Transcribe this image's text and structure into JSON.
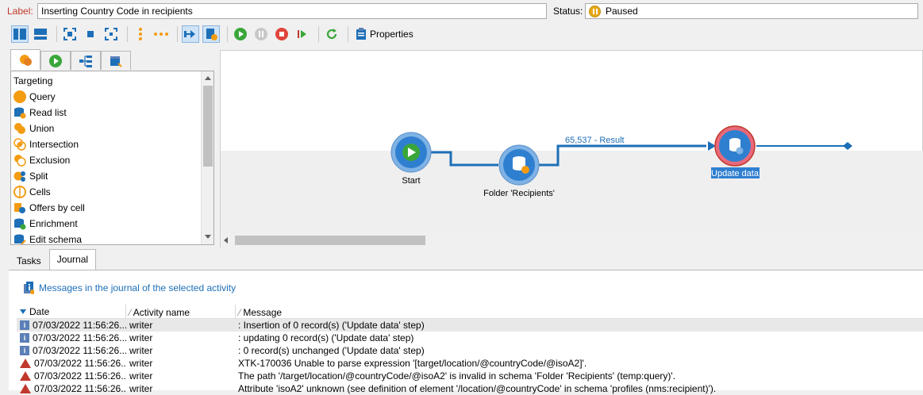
{
  "top": {
    "label_caption": "Label:",
    "label_value": "Inserting Country Code in recipients",
    "status_caption": "Status:",
    "status_value": "Paused"
  },
  "toolbar": {
    "properties_label": "Properties",
    "icons": [
      "layout-vertical-icon",
      "layout-horizontal-icon",
      "zoom-fit-icon",
      "zoom-stop-icon",
      "fit-selection-icon",
      "vertical-dots-icon",
      "horizontal-dots-icon",
      "auto-layout-icon",
      "workflow-properties-icon",
      "start-icon",
      "pause-icon",
      "stop-icon",
      "step-icon",
      "refresh-icon",
      "properties-icon"
    ]
  },
  "palette": {
    "tabs": [
      "targeting-tab",
      "flow-control-tab",
      "actions-tab",
      "events-tab"
    ],
    "section": "Targeting",
    "items": [
      {
        "label": "Query",
        "icon": "query-icon"
      },
      {
        "label": "Read list",
        "icon": "read-list-icon"
      },
      {
        "label": "Union",
        "icon": "union-icon"
      },
      {
        "label": "Intersection",
        "icon": "intersection-icon"
      },
      {
        "label": "Exclusion",
        "icon": "exclusion-icon"
      },
      {
        "label": "Split",
        "icon": "split-icon"
      },
      {
        "label": "Cells",
        "icon": "cells-icon"
      },
      {
        "label": "Offers by cell",
        "icon": "offers-by-cell-icon"
      },
      {
        "label": "Enrichment",
        "icon": "enrichment-icon"
      },
      {
        "label": "Edit schema",
        "icon": "edit-schema-icon"
      }
    ]
  },
  "canvas": {
    "nodes": {
      "start": "Start",
      "folder": "Folder 'Recipients'",
      "update": "Update data"
    },
    "transition_label": "65,537 - Result"
  },
  "bottom": {
    "tabs": [
      "Tasks",
      "Journal"
    ],
    "journal_title": "Messages in the journal of the selected activity",
    "columns": [
      "Date",
      "Activity name",
      "Message"
    ],
    "rows": [
      {
        "type": "info",
        "date": "07/03/2022 11:56:26...",
        "activity": "writer",
        "message": ": Insertion of 0 record(s) ('Update data' step)"
      },
      {
        "type": "info",
        "date": "07/03/2022 11:56:26...",
        "activity": "writer",
        "message": ": updating 0 record(s) ('Update data' step)"
      },
      {
        "type": "info",
        "date": "07/03/2022 11:56:26...",
        "activity": "writer",
        "message": ": 0 record(s) unchanged ('Update data' step)"
      },
      {
        "type": "error",
        "date": "07/03/2022 11:56:26...",
        "activity": "writer",
        "message": "XTK-170036 Unable to parse expression '[target/location/@countryCode/@isoA2]'."
      },
      {
        "type": "error",
        "date": "07/03/2022 11:56:26...",
        "activity": "writer",
        "message": "The path '/target/location/@countryCode/@isoA2' is invalid in schema 'Folder 'Recipients' (temp:query)'."
      },
      {
        "type": "error",
        "date": "07/03/2022 11:56:26...",
        "activity": "writer",
        "message": "Attribute 'isoA2' unknown (see definition of element '/location/@countryCode' in schema 'profiles (nms:recipient)')."
      }
    ]
  },
  "colors": {
    "accent_blue": "#1d6fb8",
    "pause_yellow": "#e6a817",
    "error_red": "#c0392b"
  }
}
